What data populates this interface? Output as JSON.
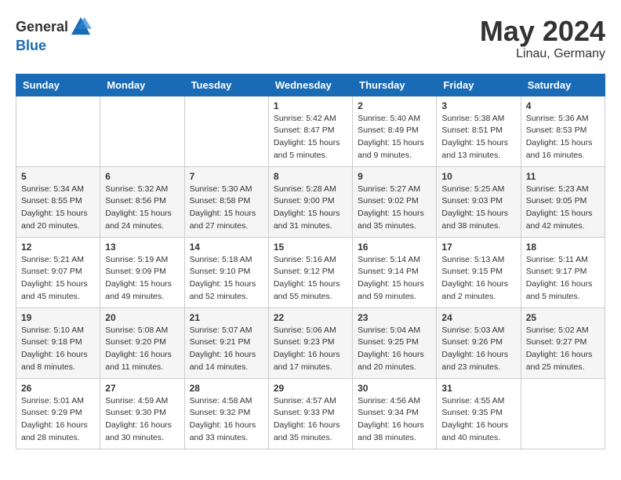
{
  "header": {
    "logo_general": "General",
    "logo_blue": "Blue",
    "month_year": "May 2024",
    "location": "Linau, Germany"
  },
  "weekdays": [
    "Sunday",
    "Monday",
    "Tuesday",
    "Wednesday",
    "Thursday",
    "Friday",
    "Saturday"
  ],
  "weeks": [
    [
      {
        "day": "",
        "info": ""
      },
      {
        "day": "",
        "info": ""
      },
      {
        "day": "",
        "info": ""
      },
      {
        "day": "1",
        "info": "Sunrise: 5:42 AM\nSunset: 8:47 PM\nDaylight: 15 hours\nand 5 minutes."
      },
      {
        "day": "2",
        "info": "Sunrise: 5:40 AM\nSunset: 8:49 PM\nDaylight: 15 hours\nand 9 minutes."
      },
      {
        "day": "3",
        "info": "Sunrise: 5:38 AM\nSunset: 8:51 PM\nDaylight: 15 hours\nand 13 minutes."
      },
      {
        "day": "4",
        "info": "Sunrise: 5:36 AM\nSunset: 8:53 PM\nDaylight: 15 hours\nand 16 minutes."
      }
    ],
    [
      {
        "day": "5",
        "info": "Sunrise: 5:34 AM\nSunset: 8:55 PM\nDaylight: 15 hours\nand 20 minutes."
      },
      {
        "day": "6",
        "info": "Sunrise: 5:32 AM\nSunset: 8:56 PM\nDaylight: 15 hours\nand 24 minutes."
      },
      {
        "day": "7",
        "info": "Sunrise: 5:30 AM\nSunset: 8:58 PM\nDaylight: 15 hours\nand 27 minutes."
      },
      {
        "day": "8",
        "info": "Sunrise: 5:28 AM\nSunset: 9:00 PM\nDaylight: 15 hours\nand 31 minutes."
      },
      {
        "day": "9",
        "info": "Sunrise: 5:27 AM\nSunset: 9:02 PM\nDaylight: 15 hours\nand 35 minutes."
      },
      {
        "day": "10",
        "info": "Sunrise: 5:25 AM\nSunset: 9:03 PM\nDaylight: 15 hours\nand 38 minutes."
      },
      {
        "day": "11",
        "info": "Sunrise: 5:23 AM\nSunset: 9:05 PM\nDaylight: 15 hours\nand 42 minutes."
      }
    ],
    [
      {
        "day": "12",
        "info": "Sunrise: 5:21 AM\nSunset: 9:07 PM\nDaylight: 15 hours\nand 45 minutes."
      },
      {
        "day": "13",
        "info": "Sunrise: 5:19 AM\nSunset: 9:09 PM\nDaylight: 15 hours\nand 49 minutes."
      },
      {
        "day": "14",
        "info": "Sunrise: 5:18 AM\nSunset: 9:10 PM\nDaylight: 15 hours\nand 52 minutes."
      },
      {
        "day": "15",
        "info": "Sunrise: 5:16 AM\nSunset: 9:12 PM\nDaylight: 15 hours\nand 55 minutes."
      },
      {
        "day": "16",
        "info": "Sunrise: 5:14 AM\nSunset: 9:14 PM\nDaylight: 15 hours\nand 59 minutes."
      },
      {
        "day": "17",
        "info": "Sunrise: 5:13 AM\nSunset: 9:15 PM\nDaylight: 16 hours\nand 2 minutes."
      },
      {
        "day": "18",
        "info": "Sunrise: 5:11 AM\nSunset: 9:17 PM\nDaylight: 16 hours\nand 5 minutes."
      }
    ],
    [
      {
        "day": "19",
        "info": "Sunrise: 5:10 AM\nSunset: 9:18 PM\nDaylight: 16 hours\nand 8 minutes."
      },
      {
        "day": "20",
        "info": "Sunrise: 5:08 AM\nSunset: 9:20 PM\nDaylight: 16 hours\nand 11 minutes."
      },
      {
        "day": "21",
        "info": "Sunrise: 5:07 AM\nSunset: 9:21 PM\nDaylight: 16 hours\nand 14 minutes."
      },
      {
        "day": "22",
        "info": "Sunrise: 5:06 AM\nSunset: 9:23 PM\nDaylight: 16 hours\nand 17 minutes."
      },
      {
        "day": "23",
        "info": "Sunrise: 5:04 AM\nSunset: 9:25 PM\nDaylight: 16 hours\nand 20 minutes."
      },
      {
        "day": "24",
        "info": "Sunrise: 5:03 AM\nSunset: 9:26 PM\nDaylight: 16 hours\nand 23 minutes."
      },
      {
        "day": "25",
        "info": "Sunrise: 5:02 AM\nSunset: 9:27 PM\nDaylight: 16 hours\nand 25 minutes."
      }
    ],
    [
      {
        "day": "26",
        "info": "Sunrise: 5:01 AM\nSunset: 9:29 PM\nDaylight: 16 hours\nand 28 minutes."
      },
      {
        "day": "27",
        "info": "Sunrise: 4:59 AM\nSunset: 9:30 PM\nDaylight: 16 hours\nand 30 minutes."
      },
      {
        "day": "28",
        "info": "Sunrise: 4:58 AM\nSunset: 9:32 PM\nDaylight: 16 hours\nand 33 minutes."
      },
      {
        "day": "29",
        "info": "Sunrise: 4:57 AM\nSunset: 9:33 PM\nDaylight: 16 hours\nand 35 minutes."
      },
      {
        "day": "30",
        "info": "Sunrise: 4:56 AM\nSunset: 9:34 PM\nDaylight: 16 hours\nand 38 minutes."
      },
      {
        "day": "31",
        "info": "Sunrise: 4:55 AM\nSunset: 9:35 PM\nDaylight: 16 hours\nand 40 minutes."
      },
      {
        "day": "",
        "info": ""
      }
    ]
  ]
}
